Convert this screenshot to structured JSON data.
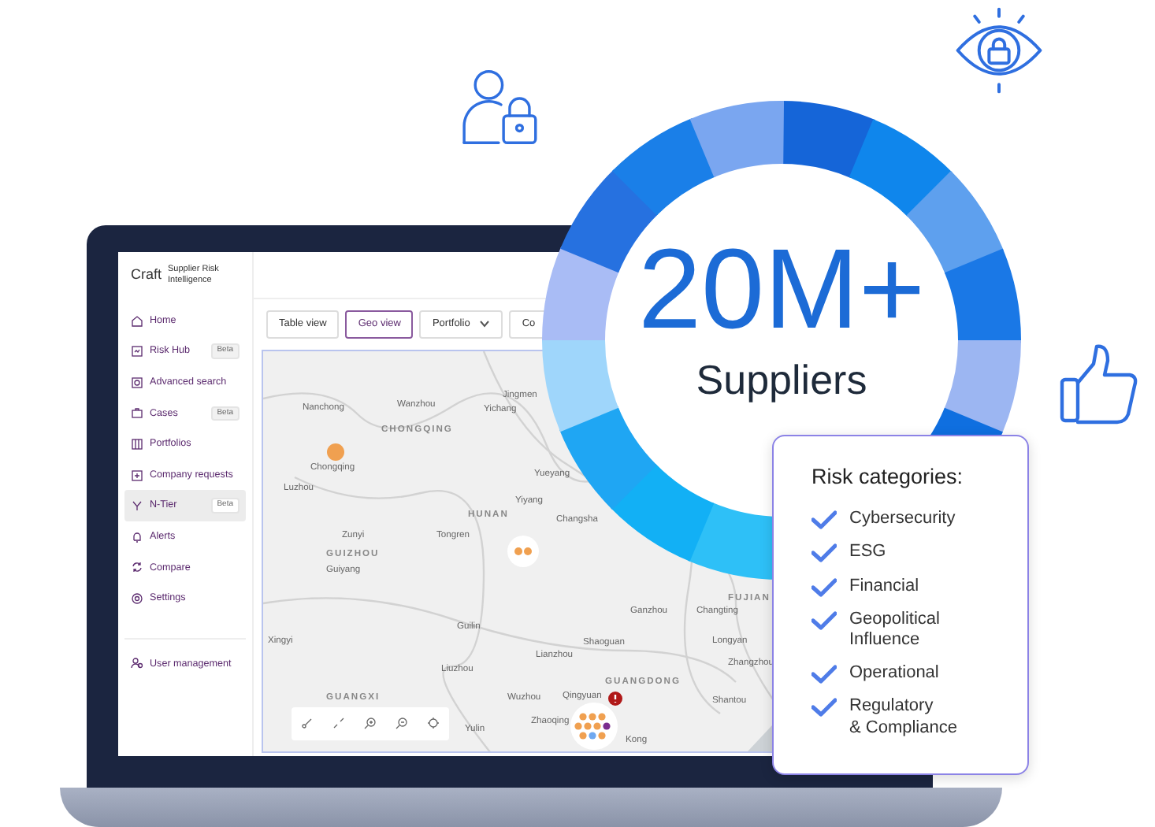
{
  "app": {
    "brand": "Craft",
    "product": "Supplier Risk Intelligence",
    "sidebar": {
      "items": [
        {
          "label": "Home",
          "selected": false
        },
        {
          "label": "Risk Hub",
          "badge": "Beta",
          "selected": false
        },
        {
          "label": "Advanced search",
          "selected": false
        },
        {
          "label": "Cases",
          "badge": "Beta",
          "selected": false
        },
        {
          "label": "Portfolios",
          "selected": false
        },
        {
          "label": "Company requests",
          "selected": false
        },
        {
          "label": "N-Tier",
          "badge": "Beta",
          "selected": true
        },
        {
          "label": "Alerts",
          "selected": false
        },
        {
          "label": "Compare",
          "selected": false
        },
        {
          "label": "Settings",
          "selected": false
        }
      ],
      "footer_items": [
        {
          "label": "User management",
          "selected": false
        }
      ]
    },
    "toolbar": [
      {
        "label": "Table view",
        "kind": "button",
        "selected": false
      },
      {
        "label": "Geo view",
        "kind": "button",
        "selected": true
      },
      {
        "label": "Portfolio",
        "kind": "dropdown",
        "selected": false
      },
      {
        "label": "Co",
        "kind": "button",
        "selected": false
      }
    ],
    "map": {
      "labels": [
        {
          "text": "Nanchong",
          "kind": "city"
        },
        {
          "text": "Wanzhou",
          "kind": "city"
        },
        {
          "text": "CHONGQING",
          "kind": "region"
        },
        {
          "text": "Yichang",
          "kind": "city"
        },
        {
          "text": "Jingmen",
          "kind": "city"
        },
        {
          "text": "Chongqing",
          "kind": "city"
        },
        {
          "text": "Luzhou",
          "kind": "city"
        },
        {
          "text": "Yueyang",
          "kind": "city"
        },
        {
          "text": "Yiyang",
          "kind": "city"
        },
        {
          "text": "HUNAN",
          "kind": "region"
        },
        {
          "text": "Changsha",
          "kind": "city"
        },
        {
          "text": "Zunyi",
          "kind": "city"
        },
        {
          "text": "Tongren",
          "kind": "city"
        },
        {
          "text": "GUIZHOU",
          "kind": "region"
        },
        {
          "text": "Guiyang",
          "kind": "city"
        },
        {
          "text": "FUJIAN",
          "kind": "region"
        },
        {
          "text": "Ganzhou",
          "kind": "city"
        },
        {
          "text": "Changting",
          "kind": "city"
        },
        {
          "text": "Guilin",
          "kind": "city"
        },
        {
          "text": "Xingyi",
          "kind": "city"
        },
        {
          "text": "Shaoguan",
          "kind": "city"
        },
        {
          "text": "Longyan",
          "kind": "city"
        },
        {
          "text": "Lianzhou",
          "kind": "city"
        },
        {
          "text": "Liuzhou",
          "kind": "city"
        },
        {
          "text": "Zhangzhou",
          "kind": "city"
        },
        {
          "text": "GUANGDONG",
          "kind": "region"
        },
        {
          "text": "GUANGXI",
          "kind": "region"
        },
        {
          "text": "Wuzhou",
          "kind": "city"
        },
        {
          "text": "Qingyuan",
          "kind": "city"
        },
        {
          "text": "Shantou",
          "kind": "city"
        },
        {
          "text": "Zhaoqing",
          "kind": "city"
        },
        {
          "text": "Yulin",
          "kind": "city"
        },
        {
          "text": "Kong",
          "kind": "city"
        }
      ]
    }
  },
  "hero": {
    "figure": "20M+",
    "caption": "Suppliers"
  },
  "risk_card": {
    "title": "Risk categories:",
    "items": [
      {
        "label": "Cybersecurity",
        "checked": true
      },
      {
        "label": "ESG",
        "checked": true
      },
      {
        "label": "Financial",
        "checked": true
      },
      {
        "label": "Geopolitical\nInfluence",
        "checked": true
      },
      {
        "label": "Operational",
        "checked": true
      },
      {
        "label": "Regulatory\n& Compliance",
        "checked": true
      }
    ]
  }
}
